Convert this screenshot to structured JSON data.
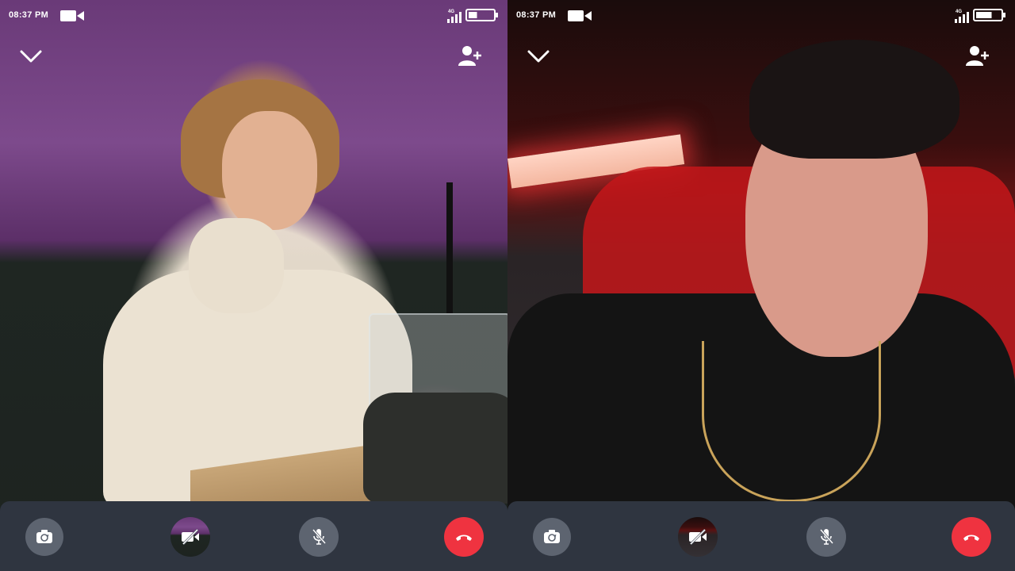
{
  "screens": [
    {
      "status": {
        "time": "08:37 PM",
        "network": "4G"
      },
      "icons": {
        "video_status": "video-camera-icon",
        "collapse": "chevron-down-icon",
        "add_participant": "add-user-icon"
      },
      "controls": [
        {
          "name": "flip-camera",
          "icon": "camera-switch-icon"
        },
        {
          "name": "video-off",
          "icon": "video-off-icon"
        },
        {
          "name": "mute",
          "icon": "mic-off-icon"
        },
        {
          "name": "end-call",
          "icon": "phone-hangup-icon"
        }
      ]
    },
    {
      "status": {
        "time": "08:37 PM",
        "network": "4G"
      },
      "icons": {
        "video_status": "video-camera-icon",
        "collapse": "chevron-down-icon",
        "add_participant": "add-user-icon"
      },
      "controls": [
        {
          "name": "flip-camera",
          "icon": "camera-switch-icon"
        },
        {
          "name": "video-off",
          "icon": "video-off-icon"
        },
        {
          "name": "mute",
          "icon": "mic-off-icon"
        },
        {
          "name": "end-call",
          "icon": "phone-hangup-icon"
        }
      ]
    }
  ],
  "battery_levels": [
    0.35,
    0.65
  ],
  "colors": {
    "control_bar": "#2f3540",
    "control_button": "#5d6470",
    "end_call": "#ef3340",
    "icon": "#ffffff"
  }
}
